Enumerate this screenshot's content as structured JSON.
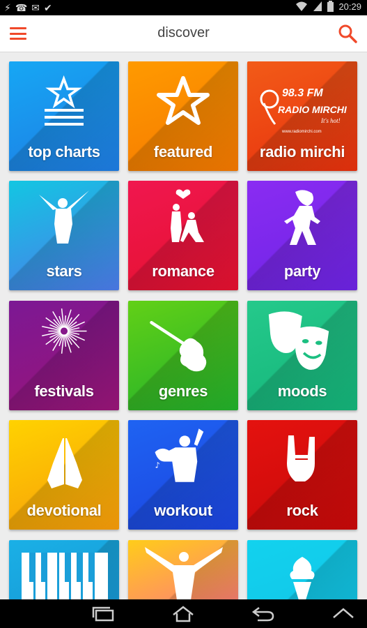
{
  "statusbar": {
    "time": "20:29",
    "notification_icons": [
      "usb-icon",
      "whatsapp-icon",
      "message-icon",
      "check-icon"
    ],
    "system_icons": [
      "wifi-icon",
      "signal-icon",
      "battery-icon"
    ]
  },
  "appbar": {
    "title": "discover"
  },
  "radio_logo": {
    "frequency": "98.3 FM",
    "name": "RADIO MIRCHI",
    "tagline": "It's hot!",
    "url": "www.radiomirchi.com"
  },
  "tiles": [
    {
      "label": "top charts",
      "icon": "star-list-icon",
      "colors": [
        "#16a7f4",
        "#1e7de4"
      ]
    },
    {
      "label": "featured",
      "icon": "star-icon",
      "colors": [
        "#ff9a00",
        "#f57900"
      ]
    },
    {
      "label": "radio mirchi",
      "icon": "radio-mirchi-logo",
      "colors": [
        "#f25b18",
        "#e8310d"
      ]
    },
    {
      "label": "stars",
      "icon": "dancer-icon",
      "colors": [
        "#13c6e2",
        "#4c7bea"
      ]
    },
    {
      "label": "romance",
      "icon": "couple-icon",
      "colors": [
        "#f0174f",
        "#e5112f"
      ]
    },
    {
      "label": "party",
      "icon": "party-dancer-icon",
      "colors": [
        "#8a2cf2",
        "#6e24e5"
      ]
    },
    {
      "label": "festivals",
      "icon": "fireworks-icon",
      "colors": [
        "#7c1894",
        "#9a1578"
      ]
    },
    {
      "label": "genres",
      "icon": "guitar-icon",
      "colors": [
        "#62d017",
        "#22b12b"
      ]
    },
    {
      "label": "moods",
      "icon": "theatre-masks-icon",
      "colors": [
        "#25c98b",
        "#14b57a"
      ]
    },
    {
      "label": "devotional",
      "icon": "praying-hands-icon",
      "colors": [
        "#ffd200",
        "#f79c0a"
      ]
    },
    {
      "label": "workout",
      "icon": "bodybuilder-icon",
      "colors": [
        "#1f63f2",
        "#1b44e0"
      ]
    },
    {
      "label": "rock",
      "icon": "rock-hand-icon",
      "colors": [
        "#e4120f",
        "#c90909"
      ]
    },
    {
      "label": "",
      "icon": "piano-keys-icon",
      "colors": [
        "#1ab0e6",
        "#1690d0"
      ]
    },
    {
      "label": "",
      "icon": "celebration-icon",
      "colors": [
        "#ffcc1a",
        "#ff5e9e"
      ]
    },
    {
      "label": "",
      "icon": "ice-cream-icon",
      "colors": [
        "#12d2ee",
        "#12c2e6"
      ]
    }
  ],
  "navbar": {
    "buttons": [
      "recent-apps-icon",
      "home-icon",
      "back-icon",
      "up-icon"
    ]
  }
}
